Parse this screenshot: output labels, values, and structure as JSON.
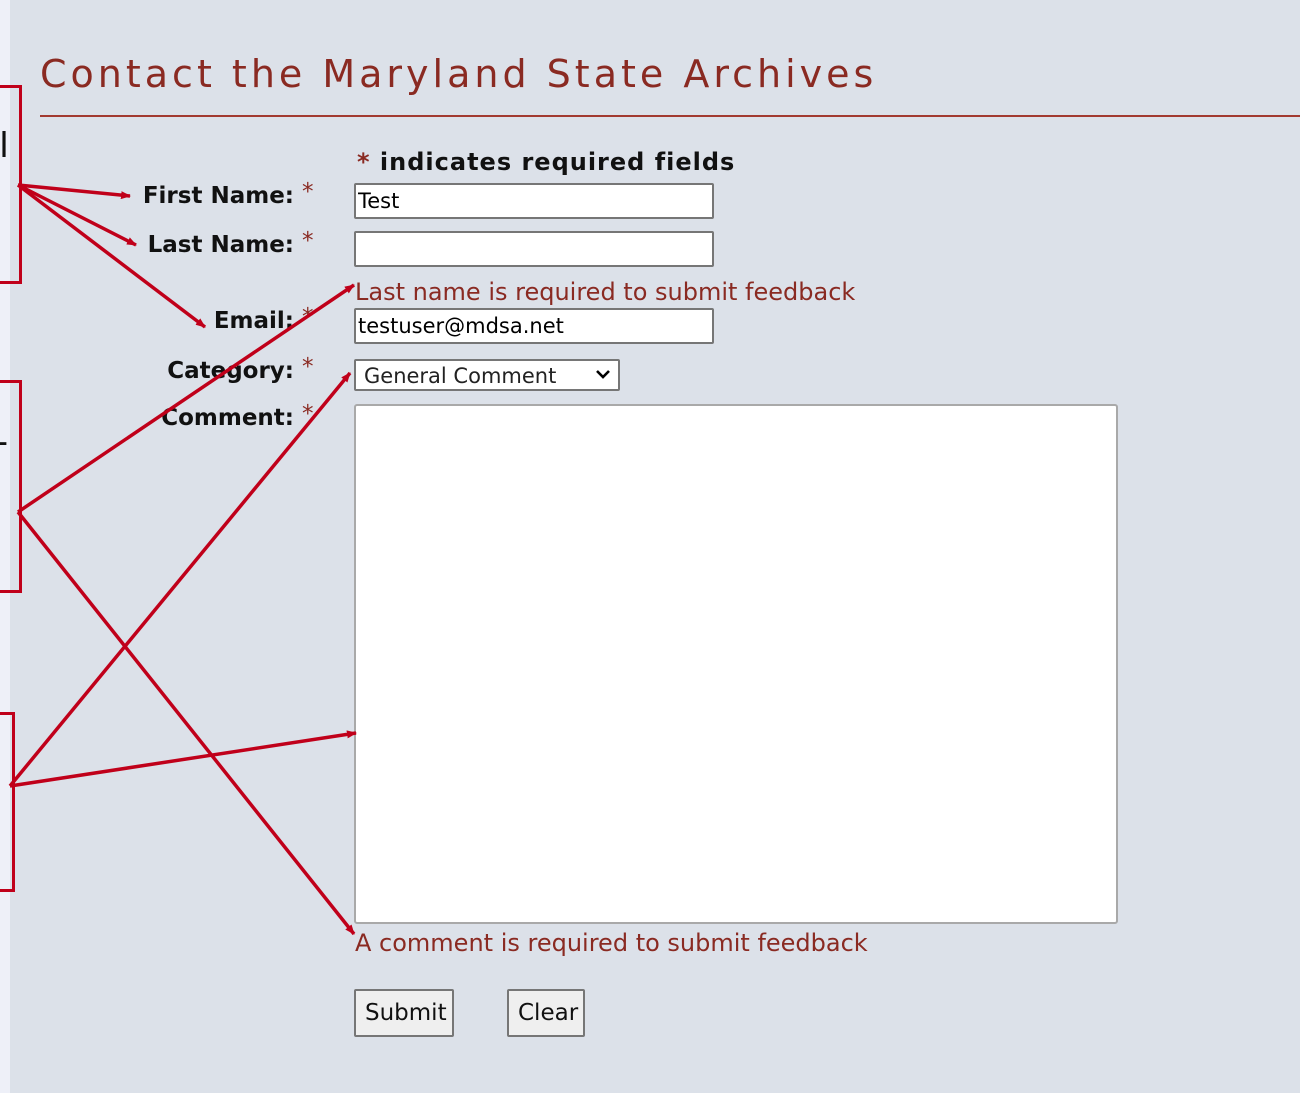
{
  "page": {
    "title": "Contact the Maryland State Archives"
  },
  "annotation": {
    "callout_1_text": "l",
    "callout_2_text": "-"
  },
  "form": {
    "required_star": "*",
    "required_note": "indicates required fields",
    "first_name": {
      "label": "First Name:",
      "value": "Test"
    },
    "last_name": {
      "label": "Last Name:",
      "value": "",
      "error": "Last name is required to submit feedback"
    },
    "email": {
      "label": "Email:",
      "value": "testuser@mdsa.net"
    },
    "category": {
      "label": "Category:",
      "selected": "General Comment"
    },
    "comment": {
      "label": "Comment:",
      "value": "",
      "error": "A comment is required to submit feedback"
    },
    "submit_label": "Submit",
    "clear_label": "Clear"
  },
  "colors": {
    "background": "#dce1e9",
    "title": "#8a2a22",
    "error": "#8a2a22",
    "annotation": "#c0001a"
  },
  "icons": {
    "select_chevron": "chevron-down-icon"
  }
}
